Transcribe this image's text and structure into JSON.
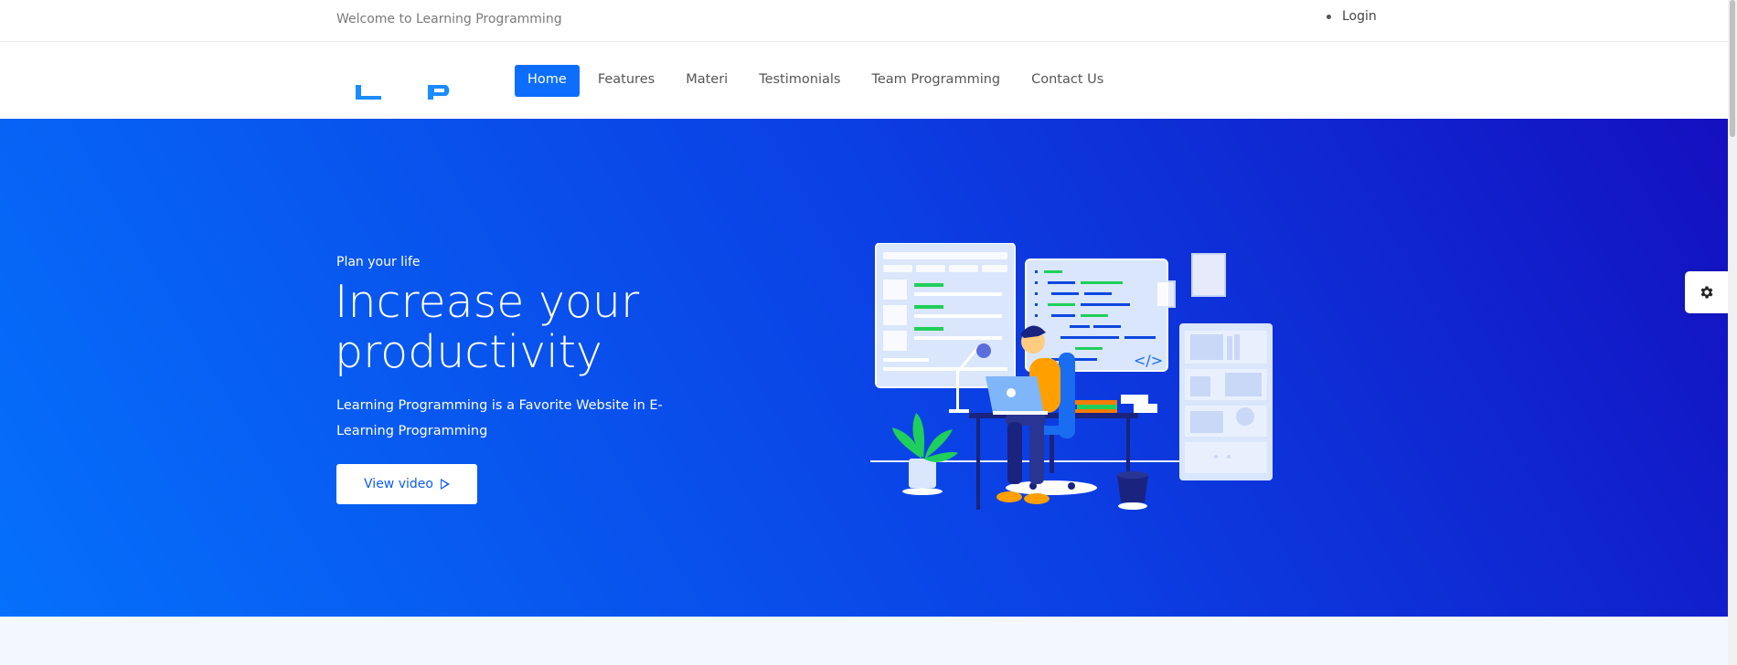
{
  "topbar": {
    "welcome_text": "Welcome to Learning Programming",
    "login_label": "Login"
  },
  "logo": {
    "text": "LP",
    "color": "#1a8cff"
  },
  "nav": {
    "items": [
      {
        "label": "Home",
        "active": true
      },
      {
        "label": "Features",
        "active": false
      },
      {
        "label": "Materi",
        "active": false
      },
      {
        "label": "Testimonials",
        "active": false
      },
      {
        "label": "Team Programming",
        "active": false
      },
      {
        "label": "Contact Us",
        "active": false
      }
    ]
  },
  "hero": {
    "eyebrow": "Plan your life",
    "headline": "Increase your productivity",
    "description": "Learning Programming is a Favorite Website in E-Learning Programming",
    "video_button_label": "View video",
    "code_symbol": "</>"
  },
  "settings": {
    "icon": "gear-icon"
  },
  "colors": {
    "primary": "#0d6efd",
    "hero_gradient_start": "#0570fb",
    "hero_gradient_end": "#1410c0",
    "lower_bg": "#f3f7fe"
  }
}
